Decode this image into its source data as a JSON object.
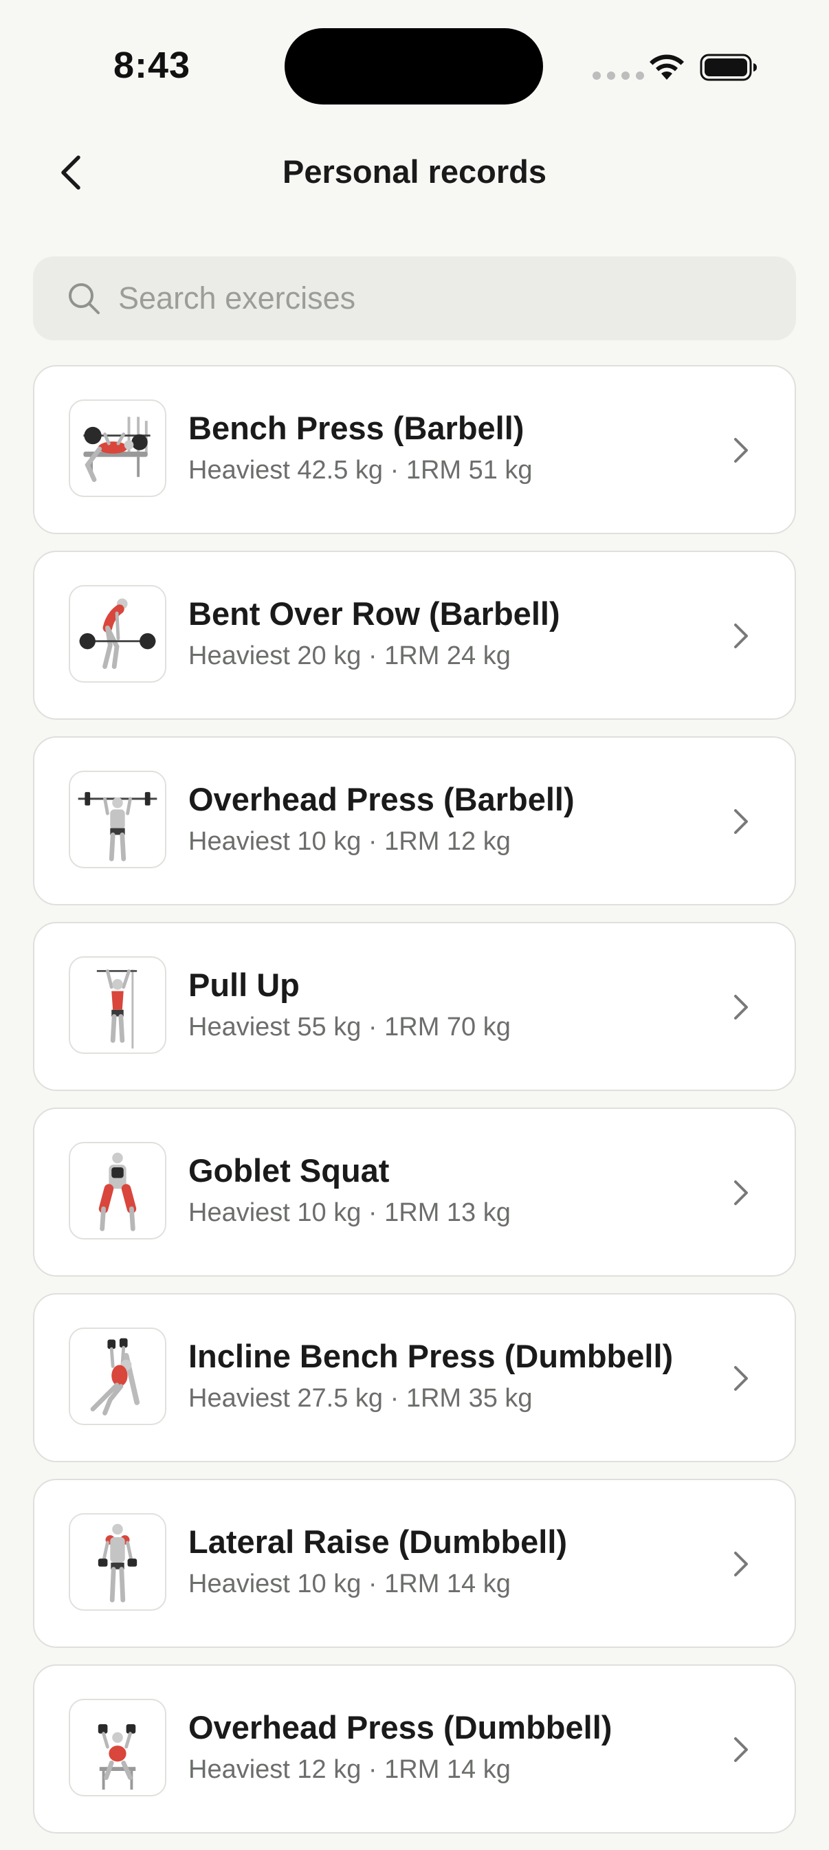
{
  "status_bar": {
    "time": "8:43"
  },
  "header": {
    "title": "Personal records",
    "back_icon": "chevron-left-icon"
  },
  "search": {
    "placeholder": "Search exercises",
    "value": "",
    "icon": "search-icon"
  },
  "exercises": [
    {
      "name": "Bench Press (Barbell)",
      "stats": "Heaviest 42.5 kg · 1RM 51 kg",
      "icon": "bench-press-icon"
    },
    {
      "name": "Bent Over Row (Barbell)",
      "stats": "Heaviest 20 kg · 1RM 24 kg",
      "icon": "bent-over-row-icon"
    },
    {
      "name": "Overhead Press (Barbell)",
      "stats": "Heaviest 10 kg · 1RM 12 kg",
      "icon": "overhead-press-icon"
    },
    {
      "name": "Pull Up",
      "stats": "Heaviest 55 kg · 1RM 70 kg",
      "icon": "pull-up-icon"
    },
    {
      "name": "Goblet Squat",
      "stats": "Heaviest 10 kg · 1RM 13 kg",
      "icon": "goblet-squat-icon"
    },
    {
      "name": "Incline Bench Press (Dumbbell)",
      "stats": "Heaviest 27.5 kg · 1RM 35 kg",
      "icon": "incline-bench-press-icon"
    },
    {
      "name": "Lateral Raise (Dumbbell)",
      "stats": "Heaviest 10 kg · 1RM 14 kg",
      "icon": "lateral-raise-icon"
    },
    {
      "name": "Overhead Press (Dumbbell)",
      "stats": "Heaviest 12 kg · 1RM 14 kg",
      "icon": "dumbbell-overhead-press-icon"
    }
  ],
  "colors": {
    "background": "#f7f7f4",
    "card_border": "#dfe0dc",
    "muscle_highlight": "#d9463b",
    "secondary_text": "#6b6e6a"
  }
}
